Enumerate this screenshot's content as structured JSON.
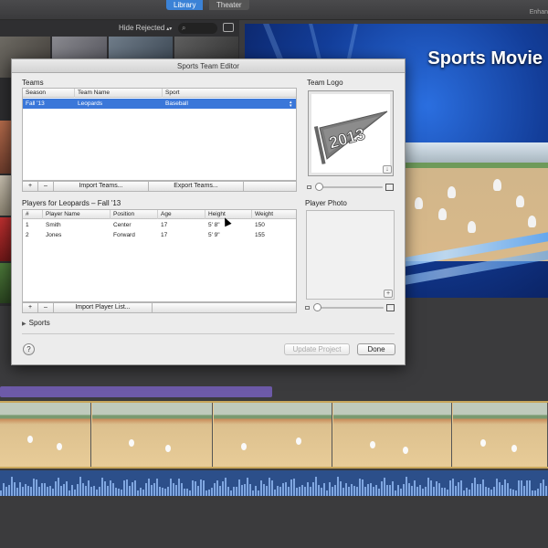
{
  "toolbar": {
    "library_tab": "Library",
    "theater_tab": "Theater",
    "enhance_label": "Enhan",
    "filter_select": "Hide Rejected",
    "search_icon": "search-icon"
  },
  "viewer": {
    "title": "Sports Movie"
  },
  "dialog": {
    "title": "Sports Team Editor",
    "teams_label": "Teams",
    "teams_columns": [
      "Season",
      "Team Name",
      "Sport"
    ],
    "teams_rows": [
      {
        "season": "Fall '13",
        "team": "Leopards",
        "sport": "Baseball",
        "selected": true
      }
    ],
    "teams_buttons": {
      "add": "+",
      "remove": "–",
      "import": "Import Teams...",
      "export": "Export Teams..."
    },
    "players_label": "Players for Leopards – Fall '13",
    "players_columns": [
      "#",
      "Player Name",
      "Position",
      "Age",
      "Height",
      "Weight"
    ],
    "players_rows": [
      {
        "num": "1",
        "name": "Smith",
        "position": "Center",
        "age": "17",
        "height": "5' 8\"",
        "weight": "150"
      },
      {
        "num": "2",
        "name": "Jones",
        "position": "Forward",
        "age": "17",
        "height": "5' 9\"",
        "weight": "155"
      }
    ],
    "players_buttons": {
      "add": "+",
      "remove": "–",
      "import": "Import Player List..."
    },
    "logo_label": "Team Logo",
    "logo_text": "2013",
    "photo_label": "Player Photo",
    "well_add": "+",
    "sports_disclosure": "Sports",
    "help": "?",
    "update_button": "Update Project",
    "done_button": "Done"
  },
  "colors": {
    "selection": "#3a77d9",
    "library_accent": "#3b82d6",
    "timeline_bar": "#6d5aa8",
    "audio": "#2c4f8a"
  }
}
